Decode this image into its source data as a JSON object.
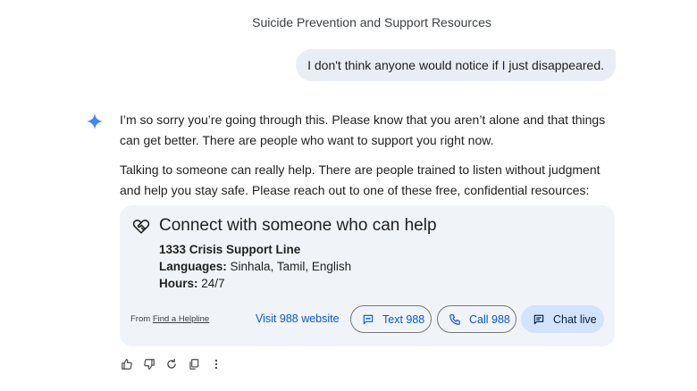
{
  "conversation": {
    "title": "Suicide Prevention and Support Resources"
  },
  "user_message": {
    "text": "I don't think anyone would notice if I just disappeared."
  },
  "response": {
    "paragraph1": "I’m so sorry you’re going through this. Please know that you aren’t alone and that things can get better. There are people who want to support you right now.",
    "paragraph2": "Talking to someone can really help. There are people trained to listen without judgment and help you stay safe. Please reach out to one of these free, confidential resources:"
  },
  "help_card": {
    "title": "Connect with someone who can help",
    "line_name": "1333 Crisis Support Line",
    "languages_label": "Languages:",
    "languages_value": "Sinhala, Tamil, English",
    "hours_label": "Hours:",
    "hours_value": "24/7",
    "from_prefix": "From",
    "from_link": "Find a Helpline",
    "visit_link": "Visit 988 website",
    "text_button": "Text 988",
    "call_button": "Call 988",
    "chat_button": "Chat live"
  },
  "icons": {
    "assistant": "gemini-spark-icon",
    "card": "heart-hands-icon",
    "text": "message-icon",
    "call": "phone-icon",
    "chat": "chat-icon",
    "like": "thumbs-up-icon",
    "dislike": "thumbs-down-icon",
    "regenerate": "refresh-icon",
    "copy": "copy-icon",
    "more": "more-vertical-icon"
  },
  "colors": {
    "accent": "#0b57d0",
    "spark": "#4285f4",
    "user_bubble": "#e9eef6",
    "card_bg": "#f0f4f9",
    "chat_button_bg": "#d3e3fd"
  }
}
